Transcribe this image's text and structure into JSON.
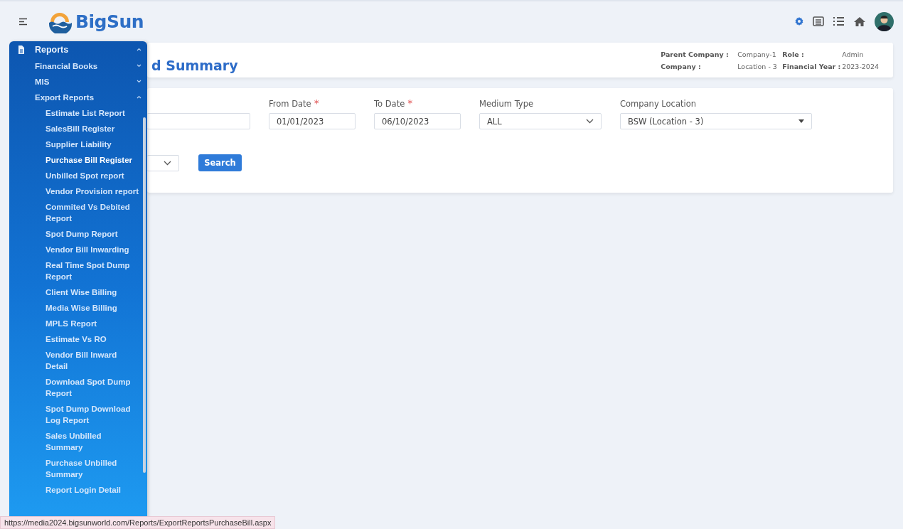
{
  "header": {
    "logo": "BigSun"
  },
  "menu": {
    "items": [
      {
        "label": "Reports",
        "expanded": true,
        "children": [
          {
            "label": "Financial Books",
            "expanded": false
          },
          {
            "label": "MIS",
            "expanded": false
          },
          {
            "label": "Export Reports",
            "expanded": true,
            "children": [
              {
                "label": "Estimate List Report",
                "selected": false
              },
              {
                "label": "SalesBill Register",
                "selected": false
              },
              {
                "label": "Supplier Liability",
                "selected": false
              },
              {
                "label": "Purchase Bill Register",
                "selected": true
              },
              {
                "label": "Unbilled Spot report",
                "selected": false
              },
              {
                "label": "Vendor Provision report",
                "selected": false
              },
              {
                "label": "Commited Vs Debited Report",
                "selected": false
              },
              {
                "label": "Spot Dump Report",
                "selected": false
              },
              {
                "label": "Vendor Bill Inwarding",
                "selected": false
              },
              {
                "label": "Real Time Spot Dump Report",
                "selected": false
              },
              {
                "label": "Client Wise Billing",
                "selected": false
              },
              {
                "label": "Media Wise Billing",
                "selected": false
              },
              {
                "label": "MPLS Report",
                "selected": false
              },
              {
                "label": "Estimate Vs RO",
                "selected": false
              },
              {
                "label": "Vendor Bill Inward Detail",
                "selected": false
              },
              {
                "label": "Download Spot Dump Report",
                "selected": false
              },
              {
                "label": "Spot Dump Download Log Report",
                "selected": false
              },
              {
                "label": "Sales Unbilled Summary",
                "selected": false
              },
              {
                "label": "Purchase Unbilled Summary",
                "selected": false
              },
              {
                "label": "Report Login Detail",
                "selected": false
              }
            ]
          }
        ]
      }
    ]
  },
  "title_card": {
    "title": "d Summary",
    "info": [
      {
        "label": "Parent Company :",
        "value": "Company-1"
      },
      {
        "label": "Role :",
        "value": "Admin"
      },
      {
        "label": "Company :",
        "value": "Location - 3"
      },
      {
        "label": "Financial Year :",
        "value": "2023-2024"
      }
    ]
  },
  "filters": {
    "fields": [
      {
        "kind": "input"
      },
      {
        "kind": "date",
        "label": "From Date",
        "required_mark": "*",
        "value": "01/01/2023"
      },
      {
        "kind": "date",
        "label": "To Date",
        "required_mark": "*",
        "value": "06/10/2023"
      },
      {
        "kind": "select",
        "label": "Medium Type",
        "value": "ALL"
      },
      {
        "kind": "combo",
        "label": "Company Location",
        "value": "BSW (Location - 3)"
      }
    ],
    "second_row": [
      {
        "kind": "select"
      }
    ],
    "search_button": "Search"
  },
  "status_bar": {
    "url": "https://media2024.bigsunworld.com/Reports/ExportReportsPurchaseBill.aspx"
  }
}
